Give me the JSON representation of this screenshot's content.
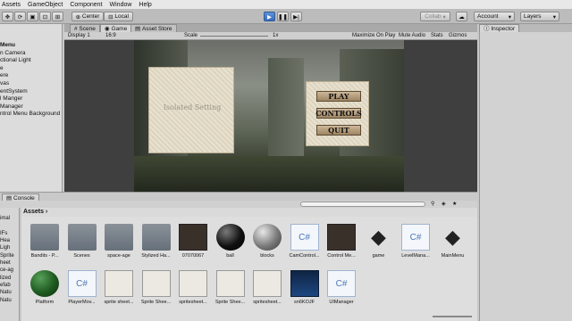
{
  "menubar": [
    "Assets",
    "GameObject",
    "Component",
    "Window",
    "Help"
  ],
  "toolbar": {
    "center_label": "Center",
    "local_label": "Local",
    "collab_label": "Collab",
    "account_label": "Account",
    "layers_label": "Layers"
  },
  "hierarchy": {
    "items": [
      "Menu",
      "n Camera",
      "ctional Light",
      "e",
      "ere",
      "vas",
      "entSystem",
      "l Manger",
      "Manager",
      "ntrol Menu Background"
    ]
  },
  "game_tabs": [
    "Scene",
    "Game",
    "Asset Store"
  ],
  "game_bar": {
    "display": "Display 1",
    "aspect": "16:9",
    "scale_label": "Scale",
    "scale_value": "1x",
    "maximize": "Maximize On Play",
    "mute": "Mute Audio",
    "stats": "Stats",
    "gizmos": "Gizmos"
  },
  "game_menu": {
    "logo_text": "Isolated Setting",
    "play": "PLAY",
    "controls": "CONTROLS",
    "quit": "QUIT"
  },
  "inspector_tab": "Inspector",
  "console_tab": "Console",
  "project": {
    "header": "Assets",
    "tree": [
      "",
      "imal",
      "",
      "IFs",
      "Hea",
      "Ligh",
      "Sprite",
      "heet",
      "ce-ag",
      "lized",
      "efab",
      "Natu",
      "Natu"
    ]
  },
  "assets": [
    {
      "name": "Bandits - P...",
      "kind": "folder"
    },
    {
      "name": "Scenes",
      "kind": "folder"
    },
    {
      "name": "space-age",
      "kind": "folder"
    },
    {
      "name": "Stylized Ha...",
      "kind": "folder"
    },
    {
      "name": "07070067",
      "kind": "dark"
    },
    {
      "name": "ball",
      "kind": "sphere-black"
    },
    {
      "name": "blocks",
      "kind": "sphere-grey"
    },
    {
      "name": "CamControl...",
      "kind": "cs"
    },
    {
      "name": "Control Me...",
      "kind": "dark"
    },
    {
      "name": "game",
      "kind": "unity"
    },
    {
      "name": "LevelMana...",
      "kind": "cs"
    },
    {
      "name": "MainMenu",
      "kind": "unity"
    },
    {
      "name": "Platform",
      "kind": "sphere-green"
    },
    {
      "name": "PlayerMov...",
      "kind": "cs"
    },
    {
      "name": "sprite sheet...",
      "kind": "sprite"
    },
    {
      "name": "Sprite Shee...",
      "kind": "sprite"
    },
    {
      "name": "spritesheet...",
      "kind": "sprite"
    },
    {
      "name": "Sprite Shee...",
      "kind": "sprite"
    },
    {
      "name": "spritesheet...",
      "kind": "sprite"
    },
    {
      "name": "sn6KOJF",
      "kind": "blue"
    },
    {
      "name": "UIManager",
      "kind": "cs"
    }
  ]
}
